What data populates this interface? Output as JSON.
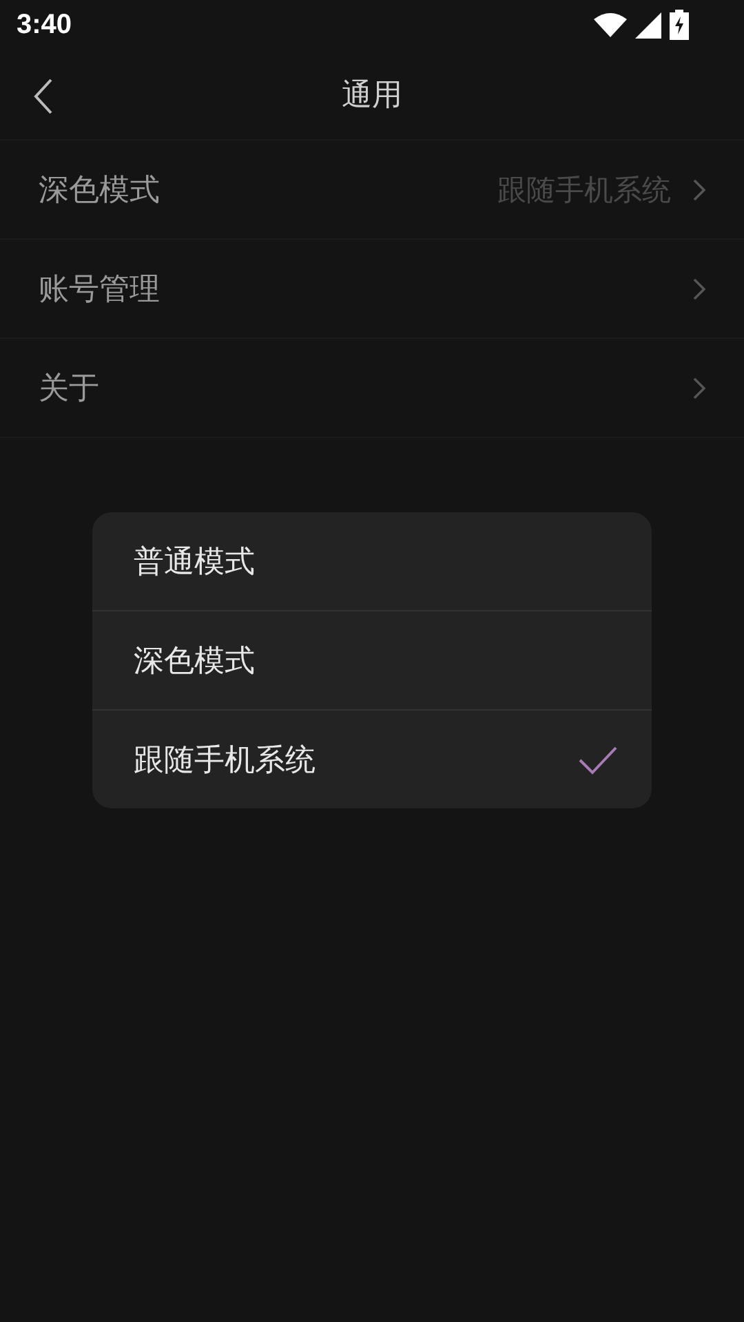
{
  "status_bar": {
    "time": "3:40"
  },
  "header": {
    "title": "通用"
  },
  "settings": [
    {
      "label": "深色模式",
      "value": "跟随手机系统"
    },
    {
      "label": "账号管理"
    },
    {
      "label": "关于"
    }
  ],
  "menu": {
    "options": [
      {
        "label": "普通模式",
        "selected": false
      },
      {
        "label": "深色模式",
        "selected": false
      },
      {
        "label": "跟随手机系统",
        "selected": true
      }
    ]
  }
}
